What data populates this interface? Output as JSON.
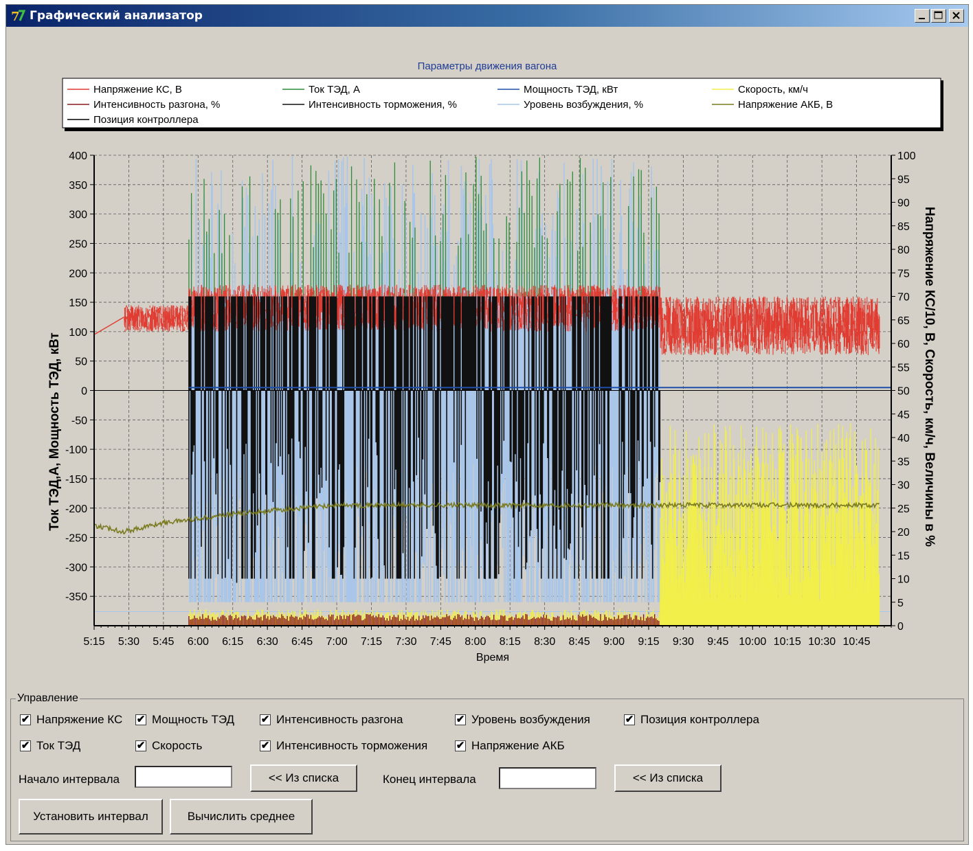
{
  "window": {
    "title": "Графический анализатор"
  },
  "chart_data": {
    "type": "line",
    "title": "Параметры движения вагона",
    "xlabel": "Время",
    "ylabel_left": "Ток ТЭД,А,    Мощность ТЭД, кВт",
    "ylabel_right": "Напряжение КС/10, В,  Скорость, км/ч, Величины в %",
    "x_ticks": [
      "5:15",
      "5:30",
      "5:45",
      "6:00",
      "6:15",
      "6:30",
      "6:45",
      "7:00",
      "7:15",
      "7:30",
      "7:45",
      "8:00",
      "8:15",
      "8:30",
      "8:45",
      "9:00",
      "9:15",
      "9:30",
      "9:45",
      "10:00",
      "10:15",
      "10:30",
      "10:45"
    ],
    "x_range_minutes": [
      315,
      660
    ],
    "y_left_ticks": [
      400,
      350,
      300,
      250,
      200,
      150,
      100,
      50,
      0,
      -50,
      -100,
      -150,
      -200,
      -250,
      -300,
      -350
    ],
    "y_left_range": [
      -400,
      400
    ],
    "y_right_ticks": [
      100,
      95,
      90,
      85,
      80,
      75,
      70,
      65,
      60,
      55,
      50,
      45,
      40,
      35,
      30,
      25,
      20,
      15,
      10,
      5,
      0
    ],
    "y_right_range": [
      0,
      100
    ],
    "grid": true,
    "legend_position": "top",
    "series": [
      {
        "name": "Напряжение КС, В",
        "color": "#e03c32"
      },
      {
        "name": "Ток ТЭД, А",
        "color": "#2e8b3a"
      },
      {
        "name": "Мощность ТЭД, кВт",
        "color": "#1f4fa8"
      },
      {
        "name": "Скорость, км/ч",
        "color": "#f2ef4a"
      },
      {
        "name": "Интенсивность разгона, %",
        "color": "#8b1a1a"
      },
      {
        "name": "Интенсивность торможения, %",
        "color": "#111111"
      },
      {
        "name": "Уровень возбуждения, %",
        "color": "#a9c6e8"
      },
      {
        "name": "Напряжение АКБ, В",
        "color": "#7a7a1e"
      },
      {
        "name": "Позиция контроллера",
        "color": "#000000"
      }
    ],
    "segments": {
      "ks_voltage_approx_V": [
        {
          "from": "5:15",
          "to": "5:28",
          "values": [
            95,
            125
          ]
        },
        {
          "from": "5:28",
          "to": "5:56",
          "values": [
            100,
            145
          ]
        },
        {
          "from": "5:56",
          "to": "9:20",
          "values": [
            100,
            180
          ]
        },
        {
          "from": "9:20",
          "to": "10:55",
          "values": [
            60,
            160
          ]
        }
      ],
      "akb_voltage_approx_left_axis": [
        {
          "time": "5:15",
          "value": -230
        },
        {
          "time": "5:28",
          "value": -240
        },
        {
          "time": "5:45",
          "value": -225
        },
        {
          "time": "6:15",
          "value": -210
        },
        {
          "time": "7:00",
          "value": -195
        },
        {
          "time": "9:20",
          "value": -195
        },
        {
          "time": "10:55",
          "value": -195
        }
      ],
      "speed_active_interval": [
        "9:20",
        "10:55"
      ],
      "traction_active_intervals": [
        [
          "5:56",
          "9:20"
        ]
      ]
    }
  },
  "panel": {
    "title": "Управление",
    "checkboxes": [
      {
        "label": "Напряжение КС",
        "checked": "✔"
      },
      {
        "label": "Мощность ТЭД",
        "checked": "✔"
      },
      {
        "label": "Интенсивность разгона",
        "checked": "✔"
      },
      {
        "label": "Уровень возбуждения",
        "checked": "✔"
      },
      {
        "label": "Позиция контроллера",
        "checked": "✔"
      },
      {
        "label": "Ток ТЭД",
        "checked": "✔"
      },
      {
        "label": "Скорость",
        "checked": "✔"
      },
      {
        "label": "Интенсивность торможения",
        "checked": "✔"
      },
      {
        "label": "Напряжение АКБ",
        "checked": "✔"
      }
    ],
    "start_label": "Начало интервала",
    "start_value": "",
    "from_list_1": "<< Из списка",
    "end_label": "Конец интервала",
    "end_value": "",
    "from_list_2": "<< Из списка",
    "set_interval": "Установить интервал",
    "compute_avg": "Вычислить среднее"
  }
}
